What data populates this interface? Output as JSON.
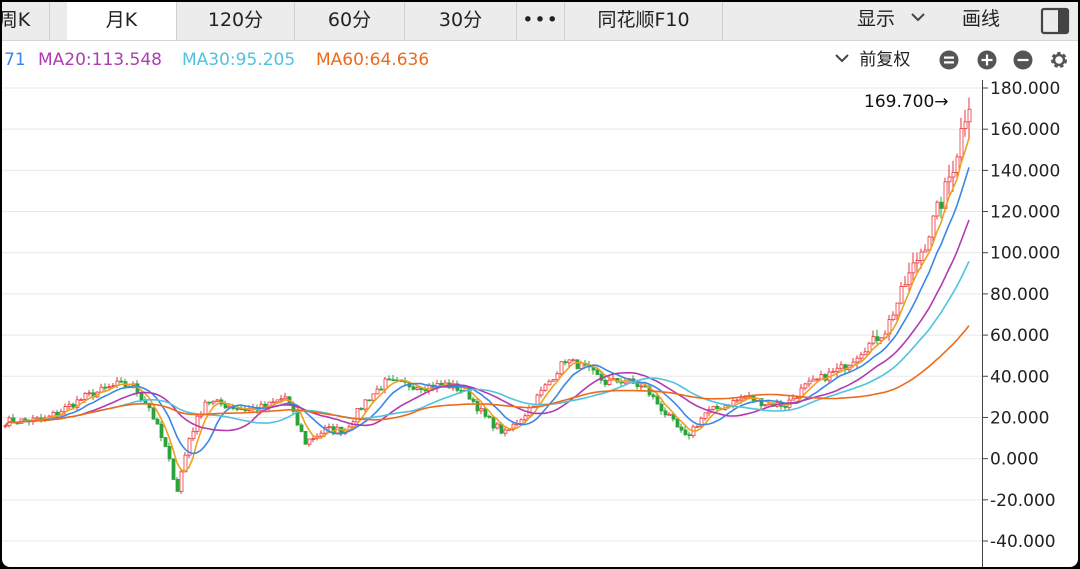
{
  "toolbar": {
    "tabs": [
      {
        "label": "周K",
        "active": false
      },
      {
        "label": "月K",
        "active": true
      },
      {
        "label": "120分",
        "active": false
      },
      {
        "label": "60分",
        "active": false
      },
      {
        "label": "30分",
        "active": false
      },
      {
        "label": "•••",
        "active": false
      },
      {
        "label": "同花顺F10",
        "active": false
      }
    ],
    "display_label": "显示",
    "draw_label": "画线"
  },
  "indicators": {
    "ma10": {
      "label": "71",
      "color": "#3a87e8"
    },
    "ma20": {
      "label": "MA20:113.548",
      "color": "#b13ab2"
    },
    "ma30": {
      "label": "MA30:95.205",
      "color": "#50c2e0"
    },
    "ma60": {
      "label": "MA60:64.636",
      "color": "#ee6a1b"
    },
    "adjust_label": "前复权"
  },
  "colors": {
    "up": "#e8363c",
    "down": "#2aa33a",
    "ma5": "#f0a020"
  },
  "chart_data": {
    "type": "candlestick",
    "ylim": [
      -40,
      180
    ],
    "yticks": [
      "180.000",
      "160.000",
      "140.000",
      "120.000",
      "100.000",
      "80.000",
      "60.000",
      "40.000",
      "20.000",
      "0.000",
      "-20.000",
      "-40.000"
    ],
    "last_price_label": "169.700→",
    "last_price": 169.7,
    "anchors": [
      [
        0,
        18
      ],
      [
        10,
        19
      ],
      [
        20,
        30
      ],
      [
        28,
        36
      ],
      [
        32,
        35
      ],
      [
        36,
        25
      ],
      [
        40,
        5
      ],
      [
        43,
        -15
      ],
      [
        46,
        10
      ],
      [
        50,
        28
      ],
      [
        55,
        26
      ],
      [
        60,
        24
      ],
      [
        65,
        25
      ],
      [
        70,
        30
      ],
      [
        75,
        8
      ],
      [
        80,
        14
      ],
      [
        85,
        14
      ],
      [
        90,
        28
      ],
      [
        95,
        37
      ],
      [
        100,
        36
      ],
      [
        105,
        35
      ],
      [
        110,
        36
      ],
      [
        115,
        33
      ],
      [
        120,
        20
      ],
      [
        125,
        12
      ],
      [
        130,
        22
      ],
      [
        135,
        35
      ],
      [
        140,
        48
      ],
      [
        145,
        44
      ],
      [
        150,
        37
      ],
      [
        155,
        38
      ],
      [
        160,
        34
      ],
      [
        165,
        22
      ],
      [
        170,
        10
      ],
      [
        175,
        22
      ],
      [
        180,
        26
      ],
      [
        185,
        30
      ],
      [
        190,
        27
      ],
      [
        195,
        26
      ],
      [
        200,
        35
      ],
      [
        205,
        40
      ],
      [
        210,
        45
      ],
      [
        215,
        54
      ],
      [
        220,
        62
      ],
      [
        225,
        85
      ],
      [
        230,
        105
      ],
      [
        235,
        130
      ],
      [
        238,
        150
      ],
      [
        240,
        168
      ],
      [
        241,
        169.7
      ]
    ]
  }
}
